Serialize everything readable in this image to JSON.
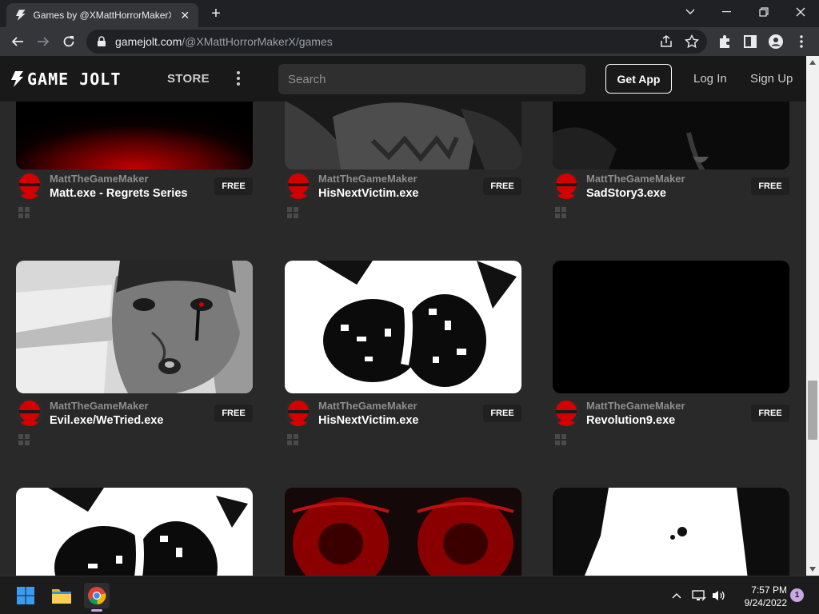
{
  "browser": {
    "tab_title": "Games by @XMattHorrorMakerX",
    "url_host": "gamejolt.com",
    "url_path": "/@XMattHorrorMakerX/games"
  },
  "header": {
    "logo_text": "GAME JOLT",
    "store": "STORE",
    "search_placeholder": "Search",
    "get_app": "Get App",
    "log_in": "Log In",
    "sign_up": "Sign Up"
  },
  "games": [
    {
      "author": "MattTheGameMaker",
      "title": "Matt.exe - Regrets Series",
      "price": "FREE"
    },
    {
      "author": "MattTheGameMaker",
      "title": "HisNextVictim.exe",
      "price": "FREE"
    },
    {
      "author": "MattTheGameMaker",
      "title": "SadStory3.exe",
      "price": "FREE"
    },
    {
      "author": "MattTheGameMaker",
      "title": "Evil.exe/WeTried.exe",
      "price": "FREE"
    },
    {
      "author": "MattTheGameMaker",
      "title": "HisNextVictim.exe",
      "price": "FREE"
    },
    {
      "author": "MattTheGameMaker",
      "title": "Revolution9.exe",
      "price": "FREE"
    }
  ],
  "taskbar": {
    "time": "7:57 PM",
    "date": "9/24/2022",
    "notifications": "1"
  },
  "colors": {
    "header_bg": "#191919",
    "content_bg": "#292929",
    "accent_red": "#d40000"
  }
}
